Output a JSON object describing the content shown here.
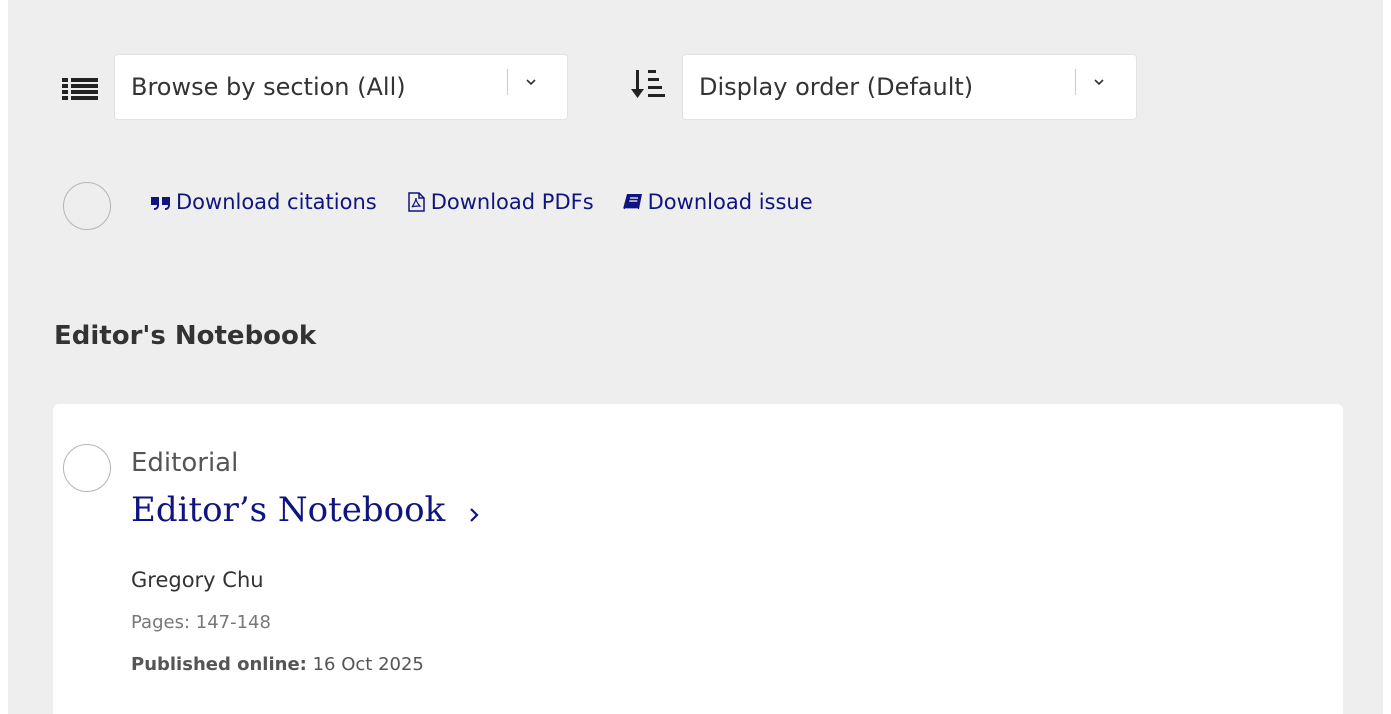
{
  "toolbar": {
    "section_select": {
      "label": "Browse by section (All)"
    },
    "order_select": {
      "label": "Display order (Default)"
    }
  },
  "downloads": {
    "citations": "Download citations",
    "pdfs": "Download PDFs",
    "issue": "Download issue"
  },
  "section": {
    "heading": "Editor's Notebook"
  },
  "article": {
    "type": "Editorial",
    "title": "Editor’s Notebook",
    "author": "Gregory Chu",
    "pages": "Pages: 147-148",
    "published_label": "Published online:",
    "published_date": "16 Oct 2025"
  },
  "icons": {
    "list": "list-icon",
    "sort": "sort-ascending-icon",
    "quote": "quote-icon",
    "pdf": "pdf-file-icon",
    "book": "book-icon",
    "chevron_down": "chevron-down-icon",
    "chevron_right": "chevron-right-icon"
  },
  "colors": {
    "background": "#eeeeee",
    "link": "#10147e",
    "text": "#333333",
    "muted": "#777777",
    "card": "#ffffff"
  }
}
